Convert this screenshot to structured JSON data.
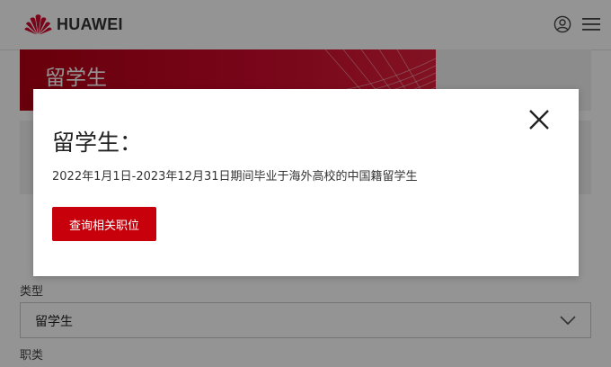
{
  "header": {
    "brand": "HUAWEI",
    "icons": {
      "logo": "huawei-flower-logo-icon",
      "user": "user-icon",
      "menu": "hamburger-menu-icon"
    },
    "brand_color": "#cf0a2c"
  },
  "banner": {
    "title": "留学生"
  },
  "filters": {
    "type_label": "类型",
    "type_value": "留学生",
    "job_label": "职类"
  },
  "modal": {
    "title": "留学生：",
    "description": "2022年1月1日-2023年12月31日期间毕业于海外高校的中国籍留学生",
    "button_label": "查询相关职位",
    "button_color": "#c7000b",
    "close_icon": "close-icon"
  }
}
